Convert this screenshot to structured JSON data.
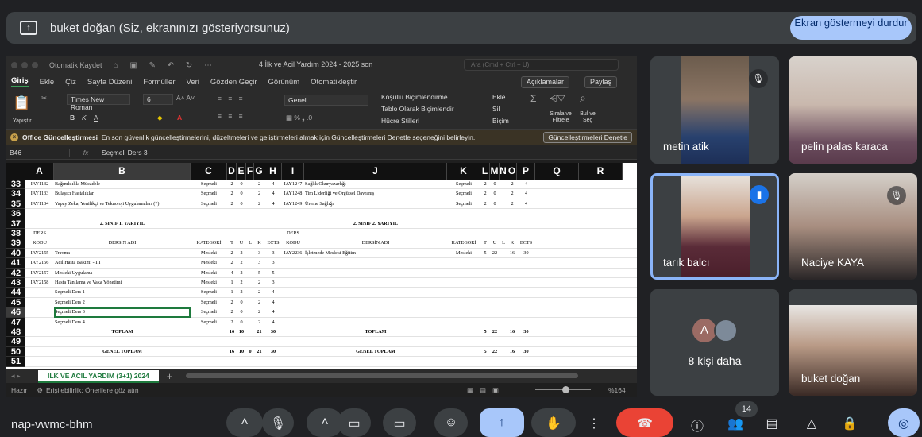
{
  "banner": {
    "text": "buket doğan (Siz, ekranınızı gösteriyorsunuz)",
    "stop_label": "Ekran göstermeyi durdur"
  },
  "excel": {
    "autosave": "Otomatik Kaydet",
    "doc_title": "4 İlk ve Acil Yardım 2024 - 2025 son",
    "search_placeholder": "Ara (Cmd + Ctrl + U)",
    "menu": [
      "Giriş",
      "Ekle",
      "Çiz",
      "Sayfa Düzeni",
      "Formüller",
      "Veri",
      "Gözden Geçir",
      "Görünüm",
      "Otomatikleştir"
    ],
    "comments_btn": "Açıklamalar",
    "share_btn": "Paylaş",
    "ribbon": {
      "paste": "Yapıştır",
      "font": "Times New Roman",
      "size": "6",
      "format": "Genel",
      "cond": "Koşullu Biçimlendirme",
      "table": "Tablo Olarak Biçimlendir",
      "styles": "Hücre Stilleri",
      "insert": "Ekle",
      "delete": "Sil",
      "formatc": "Biçim",
      "sort": "Sırala ve Filtrele",
      "find": "Bul ve Seç"
    },
    "notice": {
      "title": "Office Güncelleştirmesi",
      "text": "En son güvenlik güncelleştirmelerini, düzeltmeleri ve geliştirmeleri almak için Güncelleştirmeleri Denetle seçeneğini belirleyin.",
      "button": "Güncelleştirmeleri Denetle"
    },
    "cell_ref": "B46",
    "formula": "Seçmeli Ders 3",
    "columns": [
      "A",
      "B",
      "C",
      "D",
      "E",
      "F",
      "G",
      "H",
      "I",
      "J",
      "K",
      "L",
      "M",
      "N",
      "O",
      "P",
      "Q",
      "R"
    ],
    "rows": [
      "33",
      "34",
      "35",
      "36",
      "37",
      "38",
      "39",
      "40",
      "41",
      "42",
      "43",
      "44",
      "45",
      "46",
      "47",
      "48",
      "49",
      "50",
      "51"
    ],
    "sheet_tab": "İLK VE ACİL YARDIM (3+1) 2024",
    "status_ready": "Hazır",
    "status_access": "Erişilebilirlik: Önerilere göz atın",
    "zoom": "%164"
  },
  "grid_rows": [
    [
      "IAY1132",
      "Bağımlılıkla Mücadele",
      "Seçmeli",
      "2",
      "0",
      "",
      "2",
      "4",
      "IAY1247",
      "Sağlık Okuryazarlığı",
      "Seçmeli",
      "2",
      "0",
      "",
      "2",
      "4"
    ],
    [
      "IAY1133",
      "Bulaşıcı Hastalıklar",
      "Seçmeli",
      "2",
      "0",
      "",
      "2",
      "4",
      "IAY1248",
      "Tim Liderliği ve Örgütsel Davranış",
      "Seçmeli",
      "2",
      "0",
      "",
      "2",
      "4"
    ],
    [
      "IAY1134",
      "Yapay Zeka, Yenilikçi ve Teknoloji Uygulamaları (*)",
      "Seçmeli",
      "2",
      "0",
      "",
      "2",
      "4",
      "IAY1249",
      "Üreme Sağlığı",
      "Seçmeli",
      "2",
      "0",
      "",
      "2",
      "4"
    ],
    [
      "",
      "",
      "",
      "",
      "",
      "",
      "",
      "",
      "",
      "",
      "",
      "",
      "",
      "",
      "",
      ""
    ],
    [
      "",
      "2. SINIF 1. YARIYIL",
      "",
      "",
      "",
      "",
      "",
      "",
      "",
      "2. SINIF 2. YARIYIL",
      "",
      "",
      "",
      "",
      "",
      ""
    ],
    [
      "DERS",
      "",
      "",
      "",
      "",
      "",
      "",
      "",
      "DERS",
      "",
      "",
      "",
      "",
      "",
      "",
      ""
    ],
    [
      "KODU",
      "DERSİN ADI",
      "KATEGORİ",
      "T",
      "U",
      "L",
      "K",
      "ECTS",
      "KODU",
      "DERSİN ADI",
      "KATEGORİ",
      "T",
      "U",
      "L",
      "K",
      "ECTS"
    ],
    [
      "IAY2155",
      "Travma",
      "Mesleki",
      "2",
      "2",
      "",
      "3",
      "3",
      "IAY2236",
      "İşletmede Mesleki Eğitim",
      "Mesleki",
      "5",
      "22",
      "",
      "16",
      "30"
    ],
    [
      "IAY2156",
      "Acil Hasta Bakımı - III",
      "Mesleki",
      "2",
      "2",
      "",
      "3",
      "3",
      "",
      "",
      "",
      "",
      "",
      "",
      "",
      ""
    ],
    [
      "IAY2157",
      "Mesleki Uygulama",
      "Mesleki",
      "4",
      "2",
      "",
      "5",
      "5",
      "",
      "",
      "",
      "",
      "",
      "",
      "",
      ""
    ],
    [
      "IAY2158",
      "Hasta Tanılama ve Vaka Yönetimi",
      "Mesleki",
      "1",
      "2",
      "",
      "2",
      "3",
      "",
      "",
      "",
      "",
      "",
      "",
      "",
      ""
    ],
    [
      "",
      "Seçmeli Ders 1",
      "Seçmeli",
      "1",
      "2",
      "",
      "2",
      "4",
      "",
      "",
      "",
      "",
      "",
      "",
      "",
      ""
    ],
    [
      "",
      "Seçmeli Ders 2",
      "Seçmeli",
      "2",
      "0",
      "",
      "2",
      "4",
      "",
      "",
      "",
      "",
      "",
      "",
      "",
      ""
    ],
    [
      "",
      "Seçmeli Ders 3",
      "Seçmeli",
      "2",
      "0",
      "",
      "2",
      "4",
      "",
      "",
      "",
      "",
      "",
      "",
      "",
      ""
    ],
    [
      "",
      "Seçmeli Ders 4",
      "Seçmeli",
      "2",
      "0",
      "",
      "2",
      "4",
      "",
      "",
      "",
      "",
      "",
      "",
      "",
      ""
    ],
    [
      "",
      "TOPLAM",
      "",
      "16",
      "10",
      "",
      "21",
      "30",
      "",
      "TOPLAM",
      "",
      "5",
      "22",
      "",
      "16",
      "30"
    ],
    [
      "",
      "",
      "",
      "",
      "",
      "",
      "",
      "",
      "",
      "",
      "",
      "",
      "",
      "",
      "",
      ""
    ],
    [
      "",
      "GENEL TOPLAM",
      "",
      "16",
      "10",
      "0",
      "21",
      "30",
      "",
      "GENEL TOPLAM",
      "",
      "5",
      "22",
      "",
      "16",
      "30"
    ],
    [
      "",
      "",
      "",
      "",
      "",
      "",
      "",
      "",
      "",
      "",
      "",
      "",
      "",
      "",
      "",
      ""
    ]
  ],
  "participants": [
    {
      "name": "metin atik",
      "muted": true
    },
    {
      "name": "pelin palas karaca",
      "muted": false
    },
    {
      "name": "tarık balcı",
      "speaking": true
    },
    {
      "name": "Naciye KAYA",
      "muted": true
    },
    {
      "name": "8 kişi daha",
      "avatar_letter": "A"
    },
    {
      "name": "buket doğan"
    }
  ],
  "meeting": {
    "code": "nap-vwmc-bhm",
    "people_count": "14"
  }
}
